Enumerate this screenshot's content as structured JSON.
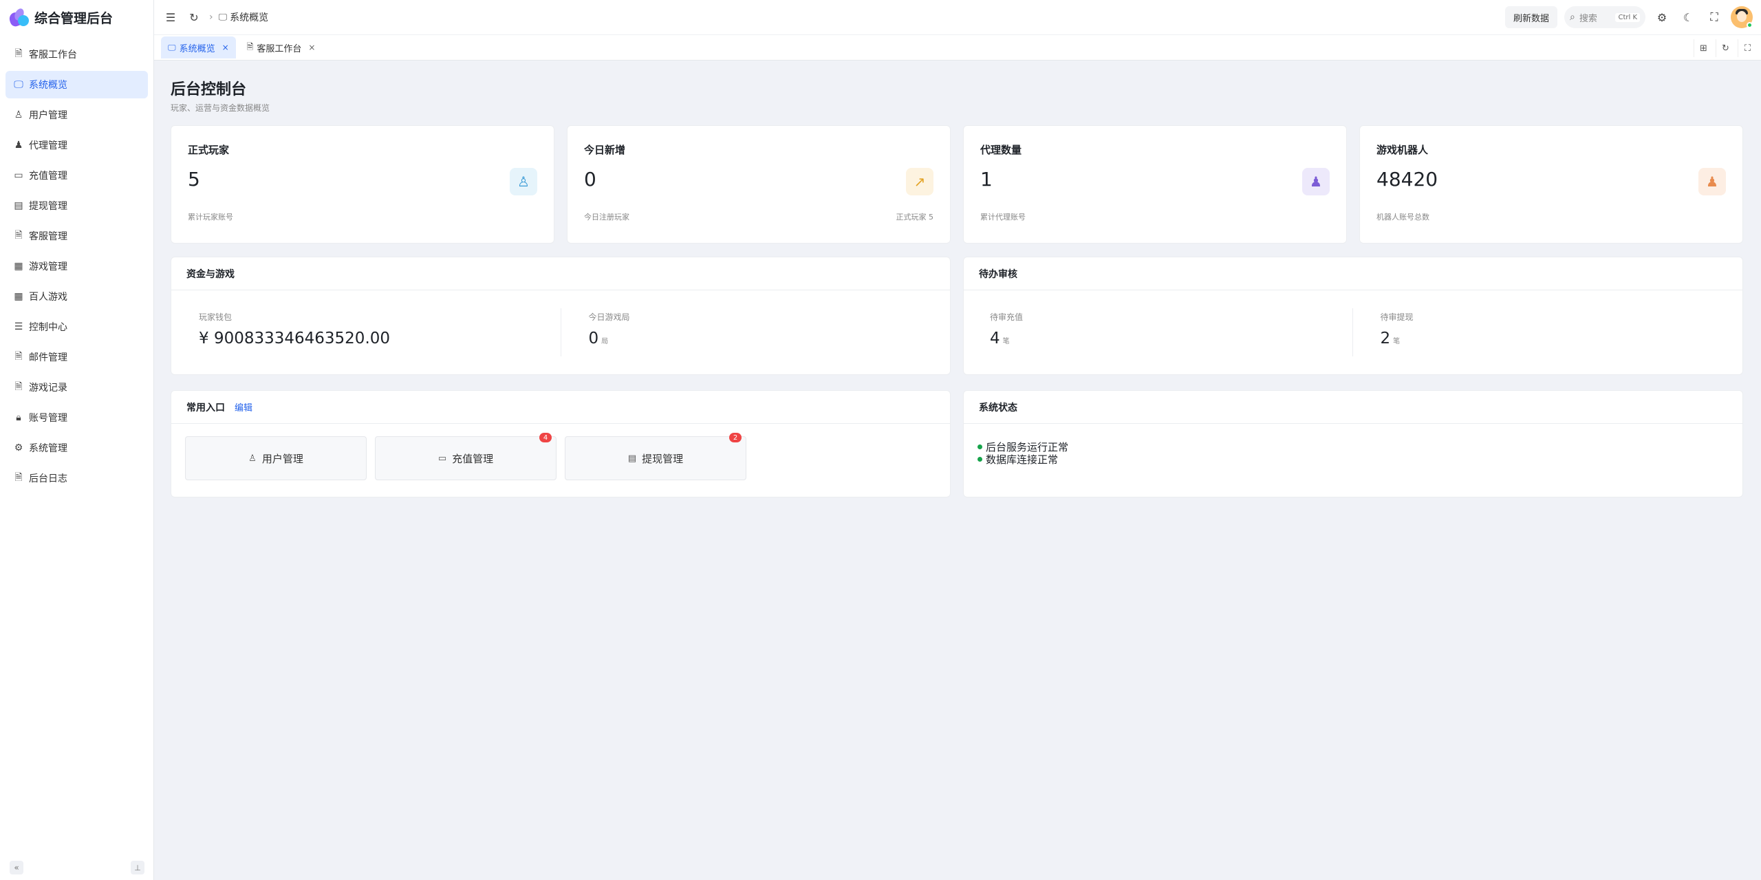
{
  "brand": {
    "title": "综合管理后台"
  },
  "sidebar": {
    "items": [
      {
        "label": "客服工作台",
        "icon": "doc-icon"
      },
      {
        "label": "系统概览",
        "icon": "dashboard-icon",
        "active": true
      },
      {
        "label": "用户管理",
        "icon": "user-icon"
      },
      {
        "label": "代理管理",
        "icon": "person-icon"
      },
      {
        "label": "充值管理",
        "icon": "card-icon"
      },
      {
        "label": "提现管理",
        "icon": "wallet-icon"
      },
      {
        "label": "客服管理",
        "icon": "doc-icon"
      },
      {
        "label": "游戏管理",
        "icon": "grid-icon"
      },
      {
        "label": "百人游戏",
        "icon": "grid-icon"
      },
      {
        "label": "控制中心",
        "icon": "sliders-icon"
      },
      {
        "label": "邮件管理",
        "icon": "doc-icon"
      },
      {
        "label": "游戏记录",
        "icon": "doc-icon"
      },
      {
        "label": "账号管理",
        "icon": "lock-icon"
      },
      {
        "label": "系统管理",
        "icon": "gear-icon"
      },
      {
        "label": "后台日志",
        "icon": "doc-icon"
      }
    ]
  },
  "header": {
    "breadcrumb": "系统概览",
    "refresh_label": "刷新数据",
    "search_placeholder": "搜索",
    "search_shortcut": "Ctrl K"
  },
  "tabs": [
    {
      "label": "系统概览",
      "active": true
    },
    {
      "label": "客服工作台",
      "active": false
    }
  ],
  "page": {
    "title": "后台控制台",
    "subtitle": "玩家、运营与资金数据概览"
  },
  "stats": [
    {
      "title": "正式玩家",
      "value": "5",
      "note": "累计玩家账号",
      "note_right": ""
    },
    {
      "title": "今日新增",
      "value": "0",
      "note": "今日注册玩家",
      "note_right": "正式玩家 5"
    },
    {
      "title": "代理数量",
      "value": "1",
      "note": "累计代理账号",
      "note_right": ""
    },
    {
      "title": "游戏机器人",
      "value": "48420",
      "note": "机器人账号总数",
      "note_right": ""
    }
  ],
  "funds": {
    "title": "资金与游戏",
    "wallet_label": "玩家钱包",
    "wallet_value": "¥ 900833346463520.00",
    "games_label": "今日游戏局",
    "games_value": "0",
    "games_unit": "局"
  },
  "pending": {
    "title": "待办审核",
    "recharge_label": "待审充值",
    "recharge_value": "4",
    "recharge_unit": "笔",
    "withdraw_label": "待审提现",
    "withdraw_value": "2",
    "withdraw_unit": "笔"
  },
  "shortcuts": {
    "title": "常用入口",
    "edit_label": "编辑",
    "items": [
      {
        "label": "用户管理",
        "icon": "user-icon",
        "badge": ""
      },
      {
        "label": "充值管理",
        "icon": "card-icon",
        "badge": "4"
      },
      {
        "label": "提现管理",
        "icon": "wallet-icon",
        "badge": "2"
      }
    ]
  },
  "system_status": {
    "title": "系统状态",
    "items": [
      "后台服务运行正常",
      "数据库连接正常"
    ],
    "ok_color": "#16a34a"
  },
  "colors": {
    "accent": "#2563eb",
    "badge": "#ef4444"
  }
}
